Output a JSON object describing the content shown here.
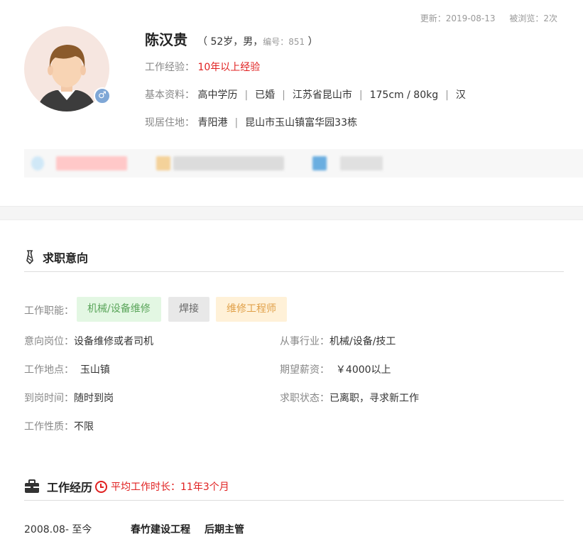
{
  "meta": {
    "updated": "更新：2019-08-13",
    "views": "被浏览：2次"
  },
  "profile": {
    "name": "陈汉贵",
    "age_gender_open": "（ 52岁，男，",
    "id_label": "编号：",
    "id_value": "851",
    "close_paren": " ）",
    "gender_icon": "male-symbol",
    "work_exp_label": "工作经验：",
    "work_exp_value": "10年以上经验",
    "basic_label": "基本资料：",
    "education": "高中学历",
    "marital": "已婚",
    "native_place": "江苏省昆山市",
    "body": "175cm / 80kg",
    "ethnicity": "汉",
    "address_label": "现居住地：",
    "district": "青阳港",
    "address": "昆山市玉山镇富华园33栋"
  },
  "job_intent": {
    "title": "求职意向",
    "functions_label": "工作职能：",
    "tags": [
      "机械/设备维修",
      "焊接",
      "维修工程师"
    ],
    "position_label": "意向岗位：",
    "position": "设备维修或者司机",
    "industry_label": "从事行业：",
    "industry": "机械/设备/技工",
    "location_label": "工作地点：",
    "location": "玉山镇",
    "salary_label": "期望薪资：",
    "salary": "￥4000以上",
    "arrival_label": "到岗时间：",
    "arrival": "随时到岗",
    "status_label": "求职状态：",
    "status": "已离职，寻求新工作",
    "nature_label": "工作性质：",
    "nature": "不限"
  },
  "work_experience": {
    "title": "工作经历",
    "avg_duration": "平均工作时长：11年3个月",
    "items": [
      {
        "period": "2008.08- 至今",
        "company": "春竹建设工程",
        "role": "后期主管"
      }
    ]
  },
  "colors": {
    "accent_red": "#e02020",
    "tag_green": "#5aa55a",
    "tag_orange": "#e0a048",
    "gender_blue": "#7fa7d6"
  }
}
